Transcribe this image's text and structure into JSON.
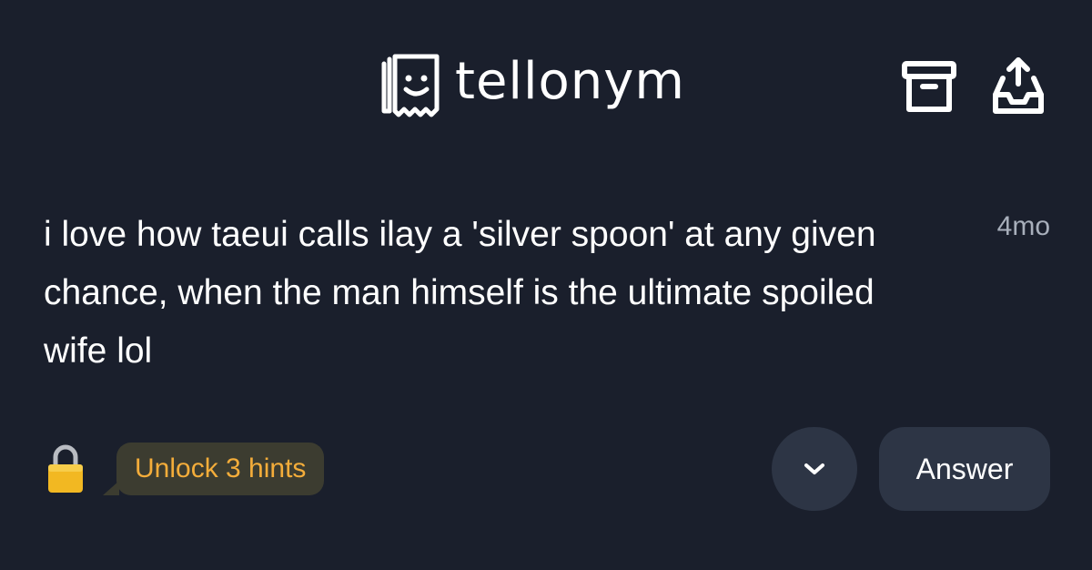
{
  "header": {
    "app_name": "tellonym",
    "archive_icon": "archive-box-icon",
    "share_icon": "share-tray-icon"
  },
  "tell": {
    "text": "i love how taeui calls ilay a 'silver spoon' at any given chance, when the man himself is the ultimate spoiled wife lol",
    "age": "4mo"
  },
  "hints": {
    "lock_icon": "lock-icon",
    "label": "Unlock 3 hints"
  },
  "actions": {
    "expand_icon": "chevron-down-icon",
    "answer_label": "Answer"
  },
  "colors": {
    "background": "#1a1f2c",
    "text": "#ffffff",
    "muted": "#a8afbb",
    "hint_text": "#f4ad3a",
    "hint_bubble": "#3c3c30",
    "button": "#2d3545"
  }
}
